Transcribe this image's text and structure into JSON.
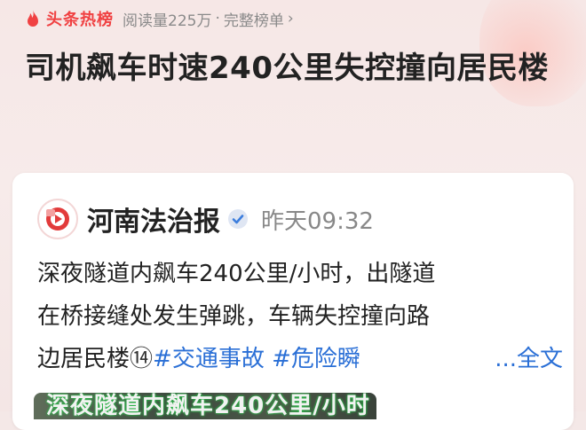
{
  "header": {
    "brand": "头条热榜",
    "read_count": "阅读量225万",
    "separator": "·",
    "full_list_link": "完整榜单",
    "chevron": "›"
  },
  "headline": "司机飙车时速240公里失控撞向居民楼",
  "post": {
    "account_name": "河南法治报",
    "time": "昨天09:32",
    "lines": [
      "深夜隧道内飙车240公里/小时，出隧道",
      "在桥接缝处发生弹跳，车辆失控撞向路"
    ],
    "line3_text": "边居民楼",
    "line3_emoji": "⑭",
    "hashtags": [
      "#交通事故",
      "#危险瞬"
    ],
    "more_link": "...全文",
    "thumbnail_caption": "深夜隧道内飙车240公里/小时"
  },
  "colors": {
    "brand_red": "#f04142",
    "link_blue": "#2a6fd6",
    "verified_blue": "#3b7ddd"
  },
  "icons": {
    "flame": "flame-icon",
    "verified": "verified-icon",
    "avatar": "henan-fazhi-logo"
  }
}
